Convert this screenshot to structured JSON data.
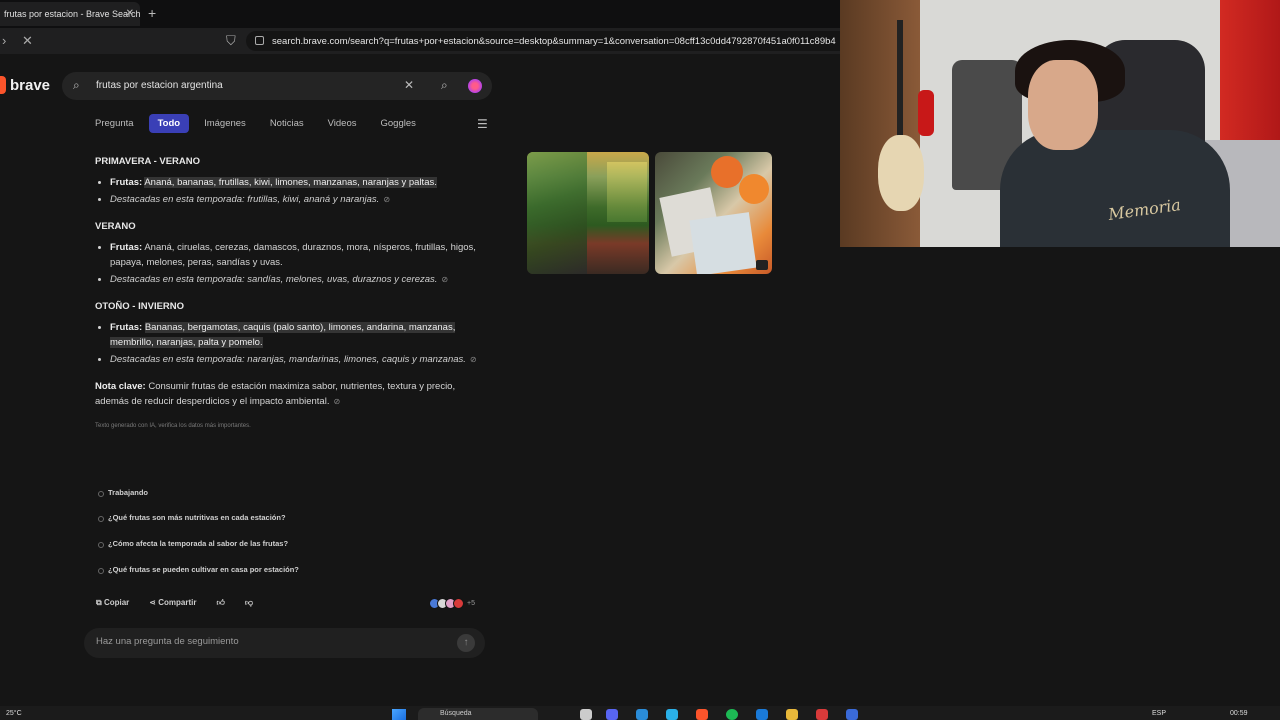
{
  "browser": {
    "tab_title": "frutas por estacion - Brave Search",
    "new_tab": "+",
    "url": "search.brave.com/search?q=frutas+por+estacion&source=desktop&summary=1&conversation=08cff13c0dd4792870f451a0f011c89b4"
  },
  "search": {
    "logo": "brave",
    "query": "frutas por estacion argentina"
  },
  "tabs": [
    {
      "label": "Pregunta"
    },
    {
      "label": "Todo"
    },
    {
      "label": "Imágenes"
    },
    {
      "label": "Noticias"
    },
    {
      "label": "Videos"
    },
    {
      "label": "Goggles"
    }
  ],
  "answer": {
    "s1": {
      "heading": "PRIMAVERA - VERANO",
      "frutas_label": "Frutas:",
      "frutas": "Ananá, bananas, frutillas, kiwi, limones, manzanas, naranjas y paltas.",
      "destacadas": "Destacadas en esta temporada: frutillas, kiwi, ananá y naranjas."
    },
    "s2": {
      "heading": "VERANO",
      "frutas_label": "Frutas:",
      "frutas": "Ananá, ciruelas, cerezas, damascos, duraznos, mora, nísperos, frutillas, higos, papaya, melones, peras, sandías y uvas.",
      "destacadas": "Destacadas en esta temporada: sandías, melones, uvas, duraznos y cerezas."
    },
    "s3": {
      "heading": "OTOÑO - INVIERNO",
      "frutas_label": "Frutas:",
      "frutas": "Bananas, bergamotas, caquis (palo santo), limones, andarina, manzanas, membrillo, naranjas, palta y pomelo.",
      "destacadas": "Destacadas en esta temporada: naranjas, mandarinas, limones, caquis y manzanas."
    },
    "note_label": "Nota clave:",
    "note": "Consumir frutas de estación maximiza sabor, nutrientes, textura y precio, además de reducir desperdicios y el impacto ambiental.",
    "disclaimer": "Texto generado con IA, verifica los datos más importantes."
  },
  "suggestions": {
    "working": "Trabajando",
    "q1": "¿Qué frutas son más nutritivas en cada estación?",
    "q2": "¿Cómo afecta la temporada al sabor de las frutas?",
    "q3": "¿Qué frutas se pueden cultivar en casa por estación?"
  },
  "actions": {
    "copy": "Copiar",
    "share": "Compartir",
    "sources_more": "+5"
  },
  "followup": {
    "placeholder": "Haz una pregunta de seguimiento"
  },
  "webcam": {
    "shirt_print": "Memoria"
  },
  "taskbar": {
    "temperature": "25°C",
    "search_label": "Búsqueda",
    "language": "ESP",
    "time": "00:59"
  },
  "colors": {
    "accent": "#3a3fb6",
    "brand": "#fb542b",
    "background": "#151515"
  }
}
